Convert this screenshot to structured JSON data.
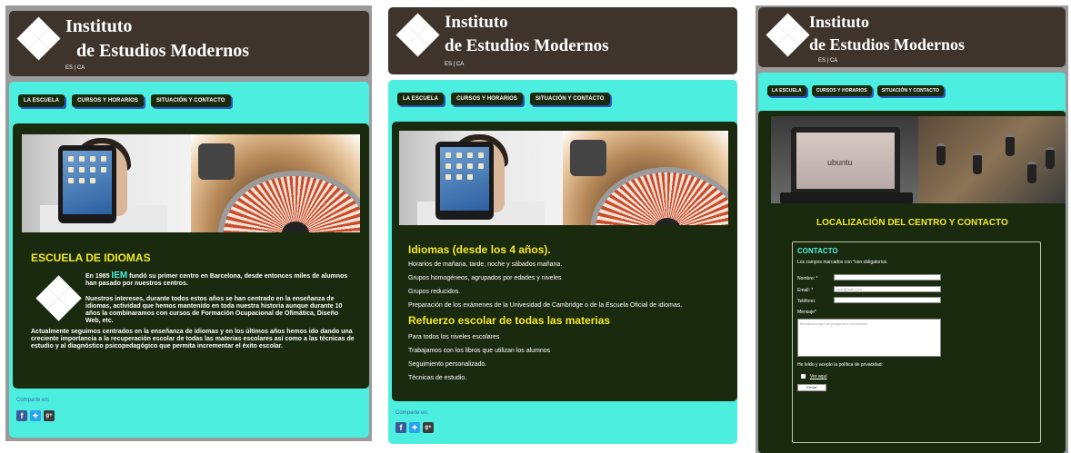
{
  "brand": {
    "line1": "Instituto",
    "line2": "de Estudios Modernos",
    "languages": "ES | CA"
  },
  "nav": {
    "school": "LA ESCUELA",
    "courses": "CURSOS Y HORARIOS",
    "contact": "SITUACIÓN Y CONTACTO"
  },
  "share": {
    "label": "Comparte en:",
    "facebook_glyph": "f",
    "google_glyph": "g+"
  },
  "colors": {
    "header": "#3f342b",
    "teal": "#4cefdf",
    "content": "#1a2a0f",
    "heading": "#f3e928"
  },
  "page1": {
    "heading": "ESCUELA DE IDIOMAS",
    "p1_prefix": "En 1985",
    "p1_brand": "IEM",
    "p1_rest": "fundó su primer centro en Barcelona, desde entonces miles de alumnos han pasado por nuestros centros.",
    "p2": "Nuestros intereses, durante todos estos años se han centrado en la enseñanza de idiomas, actividad que hemos mantenido en toda nuestra historia aunque durante 10 años la combinaramos con cursos de Formación Ocupacional de Ofimática, Diseño Web, etc.",
    "p3": "Actualmente seguimos centrados en la enseñanza de idiomas y en los últimos años hemos ido dando una creciente importancia a la recuperación escolar de todas las materias escolares así como a las técnicas de estudio y al diagnóstico psicopedagógico que permita incrementar el éxito escolar."
  },
  "page2": {
    "heading1": "Idiomas (desde los 4 años).",
    "items1": [
      "Horarios de mañana, tarde, noche y sábados mañana.",
      "Grupos homogéneos, agrupados por edades y niveles",
      "Grupos reducidos.",
      "Preparación de los exámenes de la Univesidad de Cambridge o de la Escuela Oficial de idiomas."
    ],
    "heading2": "Refuerzo escolar de todas las materias",
    "items2": [
      "Para todos los niveles escolares",
      "Trabajamos con los libros que utilizan los alumnos",
      "Seguimiento personalizado.",
      "Técnicas de estudio."
    ]
  },
  "page3": {
    "ubuntu_label": "ubuntu",
    "heading": "LOCALIZACIÓN DEL CENTRO Y CONTACTO",
    "form": {
      "title": "CONTACTO",
      "note": "Los campos marcados con *son obligatorios.",
      "name_label": "Nombre: *",
      "email_label": "Email: *",
      "email_placeholder": "user@mail.com",
      "phone_label": "Teléfono:",
      "message_label": "Mensaje*",
      "message_placeholder": "Introduzca aquí su pregunta o comentario",
      "privacy_label": "He leído y acepto la política de privacidad:",
      "privacy_link": "Ver aquí",
      "submit": "Enviar"
    }
  }
}
